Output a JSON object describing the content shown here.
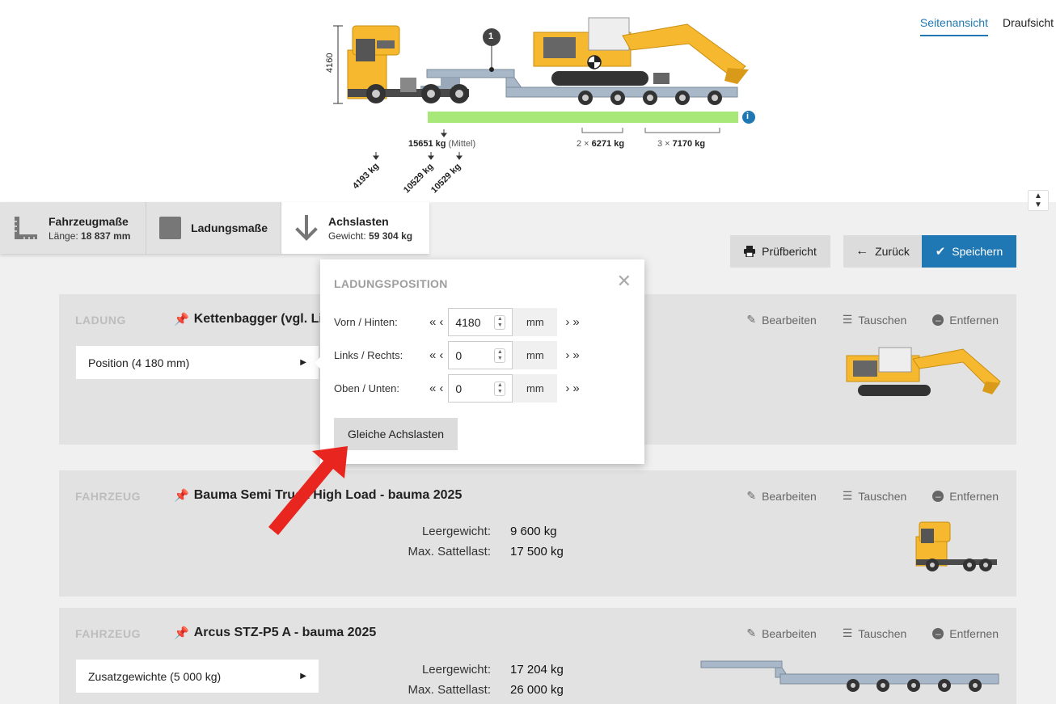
{
  "view_tabs": {
    "side": "Seitenansicht",
    "top": "Draufsicht"
  },
  "diagram": {
    "height_dim": "4160",
    "marker": "1",
    "load_mittel_value": "15651 kg",
    "load_mittel_note": "(Mittel)",
    "rot_loads": [
      "4193 kg",
      "10529 kg",
      "10529 kg"
    ],
    "group_multi_1": "2 ×",
    "group_value_1": "6271 kg",
    "group_multi_2": "3 ×",
    "group_value_2": "7170 kg",
    "info_icon": "i"
  },
  "tabs": [
    {
      "title": "Fahrzeugmaße",
      "sub_label": "Länge:",
      "sub_value": "18 837 mm"
    },
    {
      "title": "Ladungsmaße"
    },
    {
      "title": "Achslasten",
      "sub_label": "Gewicht:",
      "sub_value": "59 304 kg"
    }
  ],
  "toolbar": {
    "report": "Prüfbericht",
    "back": "Zurück",
    "save": "Speichern"
  },
  "actions": {
    "edit": "Bearbeiten",
    "swap": "Tauschen",
    "remove": "Entfernen"
  },
  "cards": [
    {
      "type": "LADUNG",
      "title": "Kettenbagger (vgl. Liebherr R 945)",
      "select": "Position (4 180 mm)"
    },
    {
      "type": "FAHRZEUG",
      "title": "Bauma Semi Truck High Load - bauma 2025",
      "kv": [
        {
          "k": "Leergewicht:",
          "v": "9 600 kg"
        },
        {
          "k": "Max. Sattellast:",
          "v": "17 500 kg"
        }
      ]
    },
    {
      "type": "FAHRZEUG",
      "title": "Arcus STZ-P5 A - bauma 2025",
      "select": "Zusatzgewichte (5 000 kg)",
      "kv": [
        {
          "k": "Leergewicht:",
          "v": "17 204 kg"
        },
        {
          "k": "Max. Sattellast:",
          "v": "26 000 kg"
        }
      ]
    }
  ],
  "popup": {
    "title": "LADUNGSPOSITION",
    "rows": [
      {
        "label": "Vorn / Hinten:",
        "value": "4180",
        "unit": "mm"
      },
      {
        "label": "Links / Rechts:",
        "value": "0",
        "unit": "mm"
      },
      {
        "label": "Oben / Unten:",
        "value": "0",
        "unit": "mm"
      }
    ],
    "button": "Gleiche Achslasten"
  },
  "colors": {
    "accent": "#1f78b4",
    "truck_yellow": "#f5b82e",
    "trailer": "#a9b8c8",
    "load_bar": "#a8e878",
    "arrow": "#e8261f"
  }
}
